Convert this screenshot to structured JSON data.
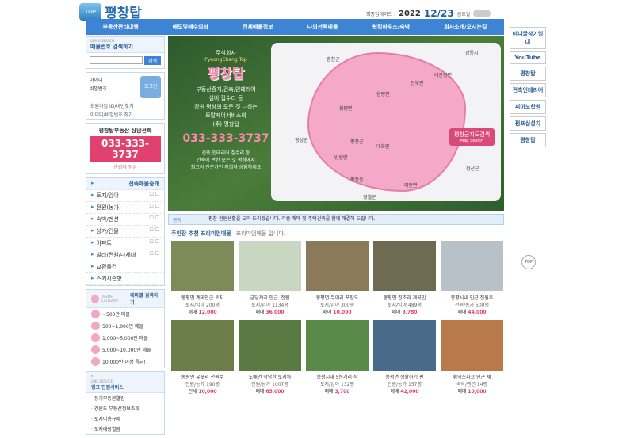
{
  "header": {
    "logo_top": "TOP",
    "logo_text": "평창탑",
    "update_label": "최종업데이트 :",
    "year": "2022",
    "date": "12/23",
    "weekday": "금요일"
  },
  "nav": [
    "부동산관리대행",
    "매도및매수의뢰",
    "전체매물정보",
    "나의선택매물",
    "워킹하우스/숙박",
    "회사소개/오시는길"
  ],
  "search": {
    "en": "QUICK SEARCH",
    "title": "매물번호 검색하기",
    "button": "검색"
  },
  "login": {
    "id": "아이디",
    "pw": "비밀번호",
    "button": "로그인",
    "links": "회원가입 ID/비번찾기",
    "links2": "아이디/비밀번호 찾기"
  },
  "call": {
    "title": "평창탑부동산 상담전화",
    "phone": "033-333-3737",
    "sub": "신뢰와 정성"
  },
  "category": {
    "title": "전속매물중개",
    "items": [
      {
        "label": "토지/임야",
        "check": "☐ ☐"
      },
      {
        "label": "전원(농가)",
        "check": "☐ ☐"
      },
      {
        "label": "숙박/펜션",
        "check": "☐ ☐"
      },
      {
        "label": "상가/건물",
        "check": "☐ ☐"
      },
      {
        "label": "아파트",
        "check": "☐ ☐"
      },
      {
        "label": "빌라/전원/다세대",
        "check": "☐ ☐"
      },
      {
        "label": "교환물건",
        "check": ""
      },
      {
        "label": "스키시즌방",
        "check": ""
      }
    ]
  },
  "price": {
    "en": "THEME CATEGORY",
    "title": "테마별 검색하기",
    "items": [
      "~500만 매물",
      "500~1,000만 매물",
      "1,000~5,000만 매물",
      "5,000~10,000만 매물",
      "10,000만 이상 특급!"
    ]
  },
  "links": {
    "en": "LINK SERVICE",
    "title": "링크 민원서비스",
    "items": [
      "등기부등본열람",
      "강원도 부동산정보조회",
      "토지이용규제",
      "토지대장열람"
    ]
  },
  "banner": {
    "kor": "주식회사",
    "eng": "PyeongChang Top",
    "name": "평창탑",
    "msg": [
      "부동산중개,건축,인테리어",
      "설비,집수리 등",
      "강원 평창의 모든 것 다하는",
      "토탈케어서비스의",
      "(주) 평창탑"
    ],
    "phone": "033-333-3737",
    "desc": [
      "건축,인테리어 집수리 등",
      "건축에 관한 모든 것 평창에서",
      "최고의 전문가인 저희와 상담하세요"
    ],
    "search": "평창군지도검색",
    "search_en": "Map Search",
    "places": [
      "홍천군",
      "강릉시",
      "대관령면",
      "진부면",
      "용평면",
      "봉평면",
      "평창군",
      "대화면",
      "방림면",
      "평창읍",
      "미탄면",
      "정선군",
      "영월군",
      "횡성군"
    ]
  },
  "ticker": {
    "tag": "공지",
    "text": "평창 전원생활을 도와 드리겠습니다. 각종 매매 및 주택건축을 함께 해결해 드립니다."
  },
  "recommend": {
    "title": "주인장 추천 프리미엄매물",
    "sub": "프리미엄매물 입니다."
  },
  "items": [
    {
      "name": "봉평면 계곡인근 토지",
      "sub": "토지/임야 200평",
      "price_label": "매매",
      "price": "12,000",
      "color": "#7d8a5a"
    },
    {
      "name": "금당계곡 인근, 전원",
      "sub": "토지/임야 1134평",
      "price_label": "매매",
      "price": "36,000",
      "color": "#c9d6c1"
    },
    {
      "name": "봉평면 무이리 포장도",
      "sub": "토지/임야 300평",
      "price_label": "매매",
      "price": "10,000",
      "color": "#8a7a5a"
    },
    {
      "name": "봉평면 진조리 계곡인",
      "sub": "토지/임야 489평",
      "price_label": "매매",
      "price": "9,780",
      "color": "#6f6a52"
    },
    {
      "name": "봉평시내 인근 전원주",
      "sub": "전원/농가 500평",
      "price_label": "매매",
      "price": "44,000",
      "color": "#b8c0c8"
    },
    {
      "name": "봉평면 유포리 전원주",
      "sub": "전원/농가 190평",
      "price_label": "전세",
      "price": "10,000",
      "color": "#6b7d48"
    },
    {
      "name": "도배면 낙낙한 토지와",
      "sub": "전원/농가 1007평",
      "price_label": "매매",
      "price": "65,000",
      "color": "#5a7a44"
    },
    {
      "name": "봉평시내 5분거리 작",
      "sub": "토지/임야 132평",
      "price_label": "매매",
      "price": "3,700",
      "color": "#5a8a4a"
    },
    {
      "name": "봉평면 생활하기 편",
      "sub": "전원/농가 157평",
      "price_label": "매매",
      "price": "42,000",
      "color": "#4a6a8a"
    },
    {
      "name": "휘닉스파크 인근 세",
      "sub": "숙박/펜션 14평",
      "price_label": "매매",
      "price": "10,000",
      "color": "#b87a4a"
    }
  ],
  "right": [
    "미니굴삭기임대",
    "YouTube",
    "평창탑",
    "건축인테리어",
    "피아노학원",
    "펌프실설치",
    "평창탑"
  ],
  "right_top": "TOP"
}
